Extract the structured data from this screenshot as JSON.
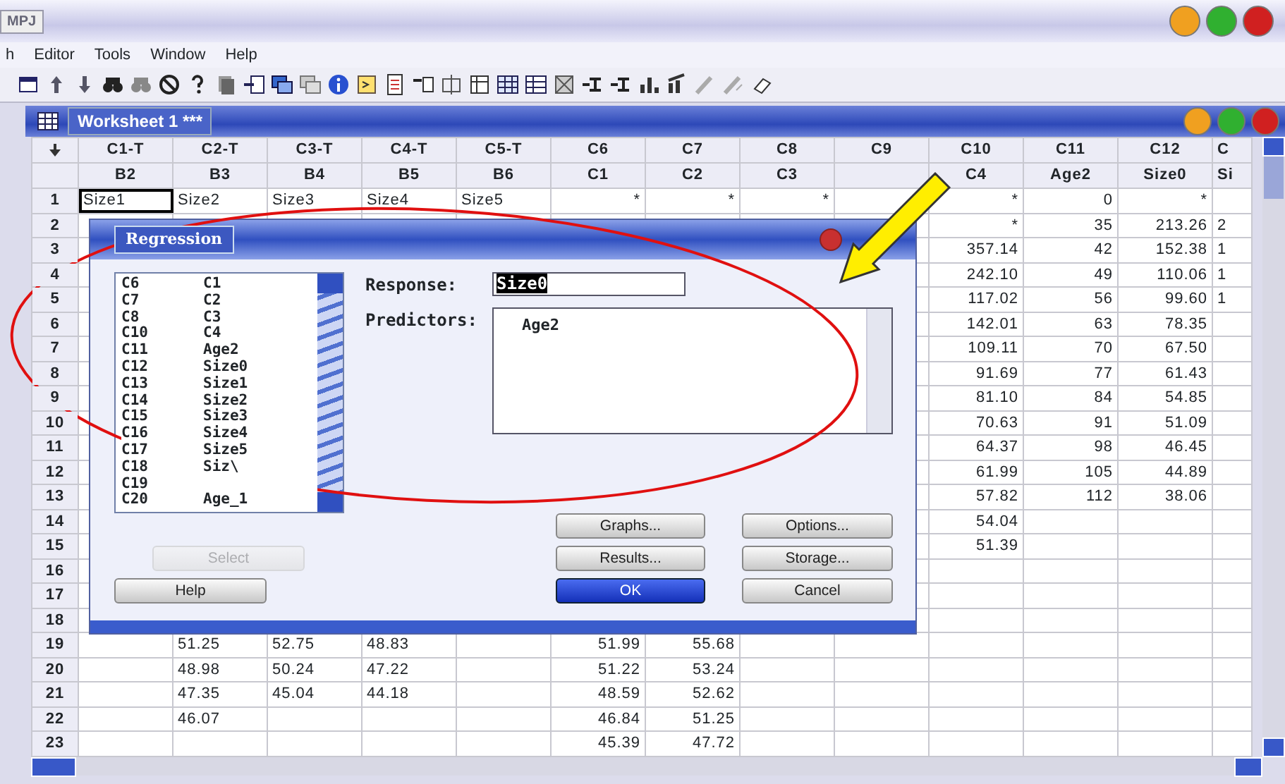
{
  "app": {
    "title": "MPJ"
  },
  "menu": [
    "h",
    "Editor",
    "Tools",
    "Window",
    "Help"
  ],
  "worksheet": {
    "title": "Worksheet 1 ***",
    "columns": [
      {
        "id": "C1-T",
        "name": "B2",
        "kind": "text"
      },
      {
        "id": "C2-T",
        "name": "B3",
        "kind": "text"
      },
      {
        "id": "C3-T",
        "name": "B4",
        "kind": "text"
      },
      {
        "id": "C4-T",
        "name": "B5",
        "kind": "text"
      },
      {
        "id": "C5-T",
        "name": "B6",
        "kind": "text"
      },
      {
        "id": "C6",
        "name": "C1",
        "kind": "numeric"
      },
      {
        "id": "C7",
        "name": "C2",
        "kind": "numeric"
      },
      {
        "id": "C8",
        "name": "C3",
        "kind": "numeric"
      },
      {
        "id": "C9",
        "kind": "numeric"
      },
      {
        "id": "C10",
        "name": "C4",
        "kind": "numeric"
      },
      {
        "id": "C11",
        "name": "Age2",
        "kind": "numeric"
      },
      {
        "id": "C12",
        "name": "Size0",
        "kind": "numeric"
      },
      {
        "id": "C",
        "name": "Si",
        "kind": "partial"
      }
    ],
    "rows": [
      {
        "number": "1",
        "cells": [
          {
            "text": "Size1",
            "selected": true
          },
          "Size2",
          "Size3",
          "Size4",
          "Size5",
          "*",
          "*",
          "*",
          null,
          "*",
          "0",
          "*",
          null
        ]
      },
      {
        "number": "2",
        "cells": [
          null,
          null,
          null,
          null,
          null,
          null,
          null,
          null,
          null,
          "*",
          "35",
          "213.26",
          "2"
        ]
      },
      {
        "number": "3",
        "cells": [
          null,
          null,
          null,
          null,
          null,
          null,
          null,
          null,
          null,
          "357.14",
          "42",
          "152.38",
          "1"
        ]
      },
      {
        "number": "4",
        "cells": [
          null,
          null,
          null,
          null,
          null,
          null,
          null,
          null,
          null,
          "242.10",
          "49",
          "110.06",
          "1"
        ]
      },
      {
        "number": "5",
        "cells": [
          null,
          null,
          null,
          null,
          null,
          null,
          null,
          null,
          null,
          "117.02",
          "56",
          "99.60",
          "1"
        ]
      },
      {
        "number": "6",
        "cells": [
          null,
          null,
          null,
          null,
          null,
          null,
          null,
          null,
          null,
          "142.01",
          "63",
          "78.35",
          null
        ]
      },
      {
        "number": "7",
        "cells": [
          null,
          null,
          null,
          null,
          null,
          null,
          null,
          null,
          null,
          "109.11",
          "70",
          "67.50",
          null
        ]
      },
      {
        "number": "8",
        "cells": [
          null,
          null,
          null,
          null,
          null,
          null,
          null,
          null,
          null,
          "91.69",
          "77",
          "61.43",
          null
        ]
      },
      {
        "number": "9",
        "cells": [
          null,
          null,
          null,
          null,
          null,
          null,
          null,
          null,
          null,
          "81.10",
          "84",
          "54.85",
          null
        ]
      },
      {
        "number": "10",
        "cells": [
          null,
          null,
          null,
          null,
          null,
          null,
          null,
          null,
          null,
          "70.63",
          "91",
          "51.09",
          null
        ]
      },
      {
        "number": "11",
        "cells": [
          null,
          null,
          null,
          null,
          null,
          null,
          null,
          null,
          null,
          "64.37",
          "98",
          "46.45",
          null
        ]
      },
      {
        "number": "12",
        "cells": [
          null,
          null,
          null,
          null,
          null,
          null,
          null,
          null,
          null,
          "61.99",
          "105",
          "44.89",
          null
        ]
      },
      {
        "number": "13",
        "cells": [
          null,
          null,
          null,
          null,
          null,
          null,
          null,
          null,
          null,
          "57.82",
          "112",
          "38.06",
          null
        ]
      },
      {
        "number": "14",
        "cells": [
          null,
          null,
          null,
          null,
          null,
          null,
          null,
          null,
          null,
          "54.04",
          null,
          null,
          null
        ]
      },
      {
        "number": "15",
        "cells": [
          null,
          null,
          null,
          null,
          null,
          null,
          null,
          null,
          null,
          "51.39",
          null,
          null,
          null
        ]
      },
      {
        "number": "16",
        "cells": [
          null,
          null,
          null,
          null,
          null,
          null,
          null,
          null,
          null,
          null,
          null,
          null,
          null
        ]
      },
      {
        "number": "17",
        "cells": [
          null,
          null,
          null,
          null,
          null,
          null,
          null,
          null,
          null,
          null,
          null,
          null,
          null
        ]
      },
      {
        "number": "18",
        "cells": [
          null,
          null,
          null,
          null,
          null,
          null,
          null,
          null,
          null,
          null,
          null,
          null,
          null
        ]
      },
      {
        "number": "19",
        "cells": [
          null,
          "51.25",
          "52.75",
          "48.83",
          null,
          "51.99",
          "55.68",
          null,
          null,
          null,
          null,
          null,
          null
        ]
      },
      {
        "number": "20",
        "cells": [
          null,
          "48.98",
          "50.24",
          "47.22",
          null,
          "51.22",
          "53.24",
          null,
          null,
          null,
          null,
          null,
          null
        ]
      },
      {
        "number": "21",
        "cells": [
          null,
          "47.35",
          "45.04",
          "44.18",
          null,
          "48.59",
          "52.62",
          null,
          null,
          null,
          null,
          null,
          null
        ]
      },
      {
        "number": "22",
        "cells": [
          null,
          "46.07",
          null,
          null,
          null,
          "46.84",
          "51.25",
          null,
          null,
          null,
          null,
          null,
          null
        ]
      },
      {
        "number": "23",
        "cells": [
          null,
          null,
          null,
          null,
          null,
          "45.39",
          "47.72",
          null,
          null,
          null,
          null,
          null,
          null
        ]
      }
    ]
  },
  "dialog": {
    "title": "Regression",
    "variables": [
      {
        "column": "C6",
        "name": "C1"
      },
      {
        "column": "C7",
        "name": "C2"
      },
      {
        "column": "C8",
        "name": "C3"
      },
      {
        "column": "C10",
        "name": "C4"
      },
      {
        "column": "C11",
        "name": "Age2"
      },
      {
        "column": "C12",
        "name": "Size0"
      },
      {
        "column": "C13",
        "name": "Size1"
      },
      {
        "column": "C14",
        "name": "Size2"
      },
      {
        "column": "C15",
        "name": "Size3"
      },
      {
        "column": "C16",
        "name": "Size4"
      },
      {
        "column": "C17",
        "name": "Size5"
      },
      {
        "column": "C18",
        "name": "Siz\\"
      },
      {
        "column": "C19"
      },
      {
        "column": "C20",
        "name": "Age_1"
      }
    ],
    "response": {
      "label": "Response:",
      "value": "Size0",
      "selected": true
    },
    "predictors": {
      "label": "Predictors:",
      "value": "Age2"
    },
    "buttons": [
      {
        "label": "Graphs...",
        "disabled": false,
        "default": false
      },
      {
        "label": "Options...",
        "disabled": false,
        "default": false
      },
      {
        "label": "Select",
        "disabled": true,
        "default": false
      },
      {
        "label": "Results...",
        "disabled": false,
        "default": false
      },
      {
        "label": "Storage...",
        "disabled": false,
        "default": false
      },
      {
        "label": "Help",
        "disabled": false,
        "default": false
      },
      {
        "label": "OK",
        "disabled": false,
        "default": true
      },
      {
        "label": "Cancel",
        "disabled": false,
        "default": false
      }
    ]
  }
}
